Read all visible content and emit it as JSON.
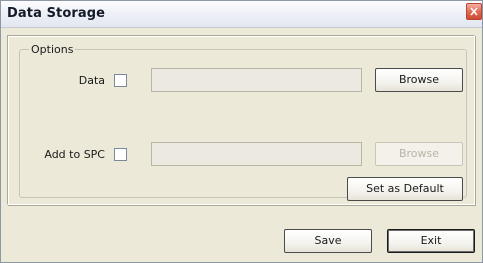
{
  "window": {
    "title": "Data Storage",
    "close_icon": "close-x-icon"
  },
  "options_group": {
    "legend": "Options",
    "data_row": {
      "label": "Data",
      "checked": false,
      "path_value": "",
      "browse_label": "Browse",
      "browse_enabled": true
    },
    "spc_row": {
      "label": "Add to SPC",
      "checked": false,
      "path_value": "",
      "browse_label": "Browse",
      "browse_enabled": false
    },
    "set_default_label": "Set as Default"
  },
  "footer": {
    "save_label": "Save",
    "exit_label": "Exit"
  },
  "colors": {
    "dialog_bg": "#ece9d8",
    "close_button": "#e06b55",
    "disabled_text": "#b8b4a6"
  }
}
